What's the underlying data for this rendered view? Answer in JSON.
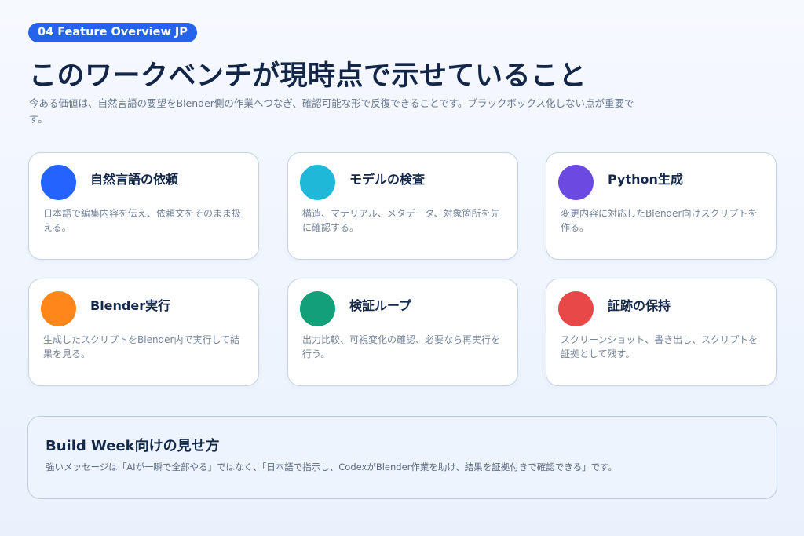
{
  "header": {
    "badge": "04  Feature Overview JP",
    "title": "このワークベンチが現時点で示せていること",
    "subtitle": "今ある価値は、自然言語の要望をBlender側の作業へつなぎ、確認可能な形で反復できることです。ブラックボックス化しない点が重要です。"
  },
  "cards": [
    {
      "title": "自然言語の依頼",
      "desc": "日本語で編集内容を伝え、依頼文をそのまま扱える。",
      "color": "#2563ff"
    },
    {
      "title": "モデルの検査",
      "desc": "構造、マテリアル、メタデータ、対象箇所を先に確認する。",
      "color": "#1fb8d8"
    },
    {
      "title": "Python生成",
      "desc": "変更内容に対応したBlender向けスクリプトを作る。",
      "color": "#6a4ae0"
    },
    {
      "title": "Blender実行",
      "desc": "生成したスクリプトをBlender内で実行して結果を見る。",
      "color": "#ff861a"
    },
    {
      "title": "検証ループ",
      "desc": "出力比較、可視変化の確認、必要なら再実行を行う。",
      "color": "#12a078"
    },
    {
      "title": "証跡の保持",
      "desc": "スクリーンショット、書き出し、スクリプトを証拠として残す。",
      "color": "#e84848"
    }
  ],
  "bottom": {
    "title": "Build Week向けの見せ方",
    "desc": "強いメッセージは「AIが一瞬で全部やる」ではなく、「日本語で指示し、CodexがBlender作業を助け、結果を証拠付きで確認できる」です。"
  }
}
